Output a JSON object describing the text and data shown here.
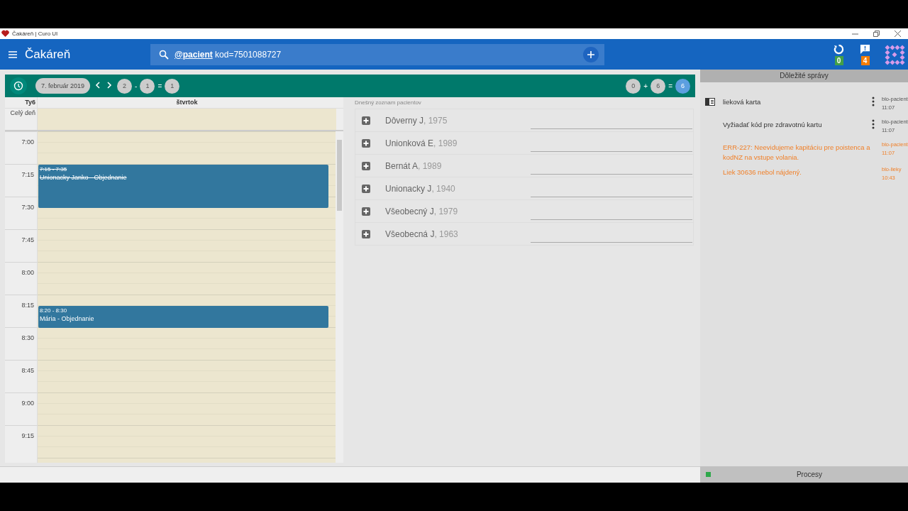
{
  "window": {
    "title": "Čakáreň | Curo UI"
  },
  "app_bar": {
    "title": "Čakáreň",
    "search": {
      "tag": "@pacient",
      "query": "kod=7501088727"
    },
    "indicators": [
      {
        "kind": "sync",
        "badge": "0",
        "color": "#43a047"
      },
      {
        "kind": "message",
        "badge": "4",
        "color": "#f57c00"
      }
    ]
  },
  "toolbar": {
    "date": "7. február 2019",
    "left_counts": [
      {
        "text": "2",
        "kind": "chip",
        "highlighted": false
      },
      {
        "text": "-",
        "kind": "op"
      },
      {
        "text": "1",
        "kind": "chip",
        "highlighted": false
      },
      {
        "text": "=",
        "kind": "op"
      },
      {
        "text": "1",
        "kind": "chip",
        "highlighted": false
      }
    ],
    "right_counts": [
      {
        "text": "0",
        "kind": "chip",
        "highlighted": false
      },
      {
        "text": "+",
        "kind": "op"
      },
      {
        "text": "6",
        "kind": "chip",
        "highlighted": false
      },
      {
        "text": "=",
        "kind": "op"
      },
      {
        "text": "6",
        "kind": "chip",
        "highlighted": true
      }
    ]
  },
  "calendar": {
    "week": "Ty6",
    "day": "štvrtok",
    "all_day": "Celý deň",
    "slots": [
      {
        "time": "7:00"
      },
      {
        "time": "7:15",
        "events": [
          {
            "time": "7:15 - 7:35",
            "title": "Unionacky Janko - Objednanie",
            "cancelled": true
          }
        ]
      },
      {
        "time": "7:30"
      },
      {
        "time": "7:45"
      },
      {
        "time": "8:00"
      },
      {
        "time": "8:15",
        "events": [
          {
            "time": "8:20 - 8:30",
            "title": "Mária - Objednanie",
            "cancelled": false
          }
        ]
      },
      {
        "time": "8:30"
      },
      {
        "time": "8:45"
      },
      {
        "time": "9:00"
      },
      {
        "time": "9:15"
      }
    ]
  },
  "patients": {
    "title": "Dnešný zoznam pacientov",
    "items": [
      {
        "name": "Dôverny J",
        "year": ", 1975"
      },
      {
        "name": "Unionková E",
        "year": ", 1989"
      },
      {
        "name": "Bernát A",
        "year": ", 1989"
      },
      {
        "name": "Unionacky J",
        "year": ", 1940"
      },
      {
        "name": "Všeobecný J",
        "year": ", 1979"
      },
      {
        "name": "Všeobecná J",
        "year": ", 1963"
      }
    ]
  },
  "messages": {
    "title": "Dôležité správy",
    "items": [
      {
        "kind": "card",
        "text": "lieková karta",
        "source": "blo-pacient",
        "time": "11:07"
      },
      {
        "kind": "action",
        "text": "Vyžiadať kód pre zdravotnú kartu",
        "source": "blo-pacient",
        "time": "11:07"
      },
      {
        "kind": "error",
        "text": "ERR-227: Neevidujeme kapitáciu pre poistenca a kodNZ na vstupe volania.",
        "source": "blo-pacient",
        "time": "11:07"
      },
      {
        "kind": "error",
        "text": "Liek 30636 nebol nájdený.",
        "source": "blo-lieky",
        "time": "10:43"
      }
    ]
  },
  "status_bar": {
    "processes": "Procesy"
  }
}
